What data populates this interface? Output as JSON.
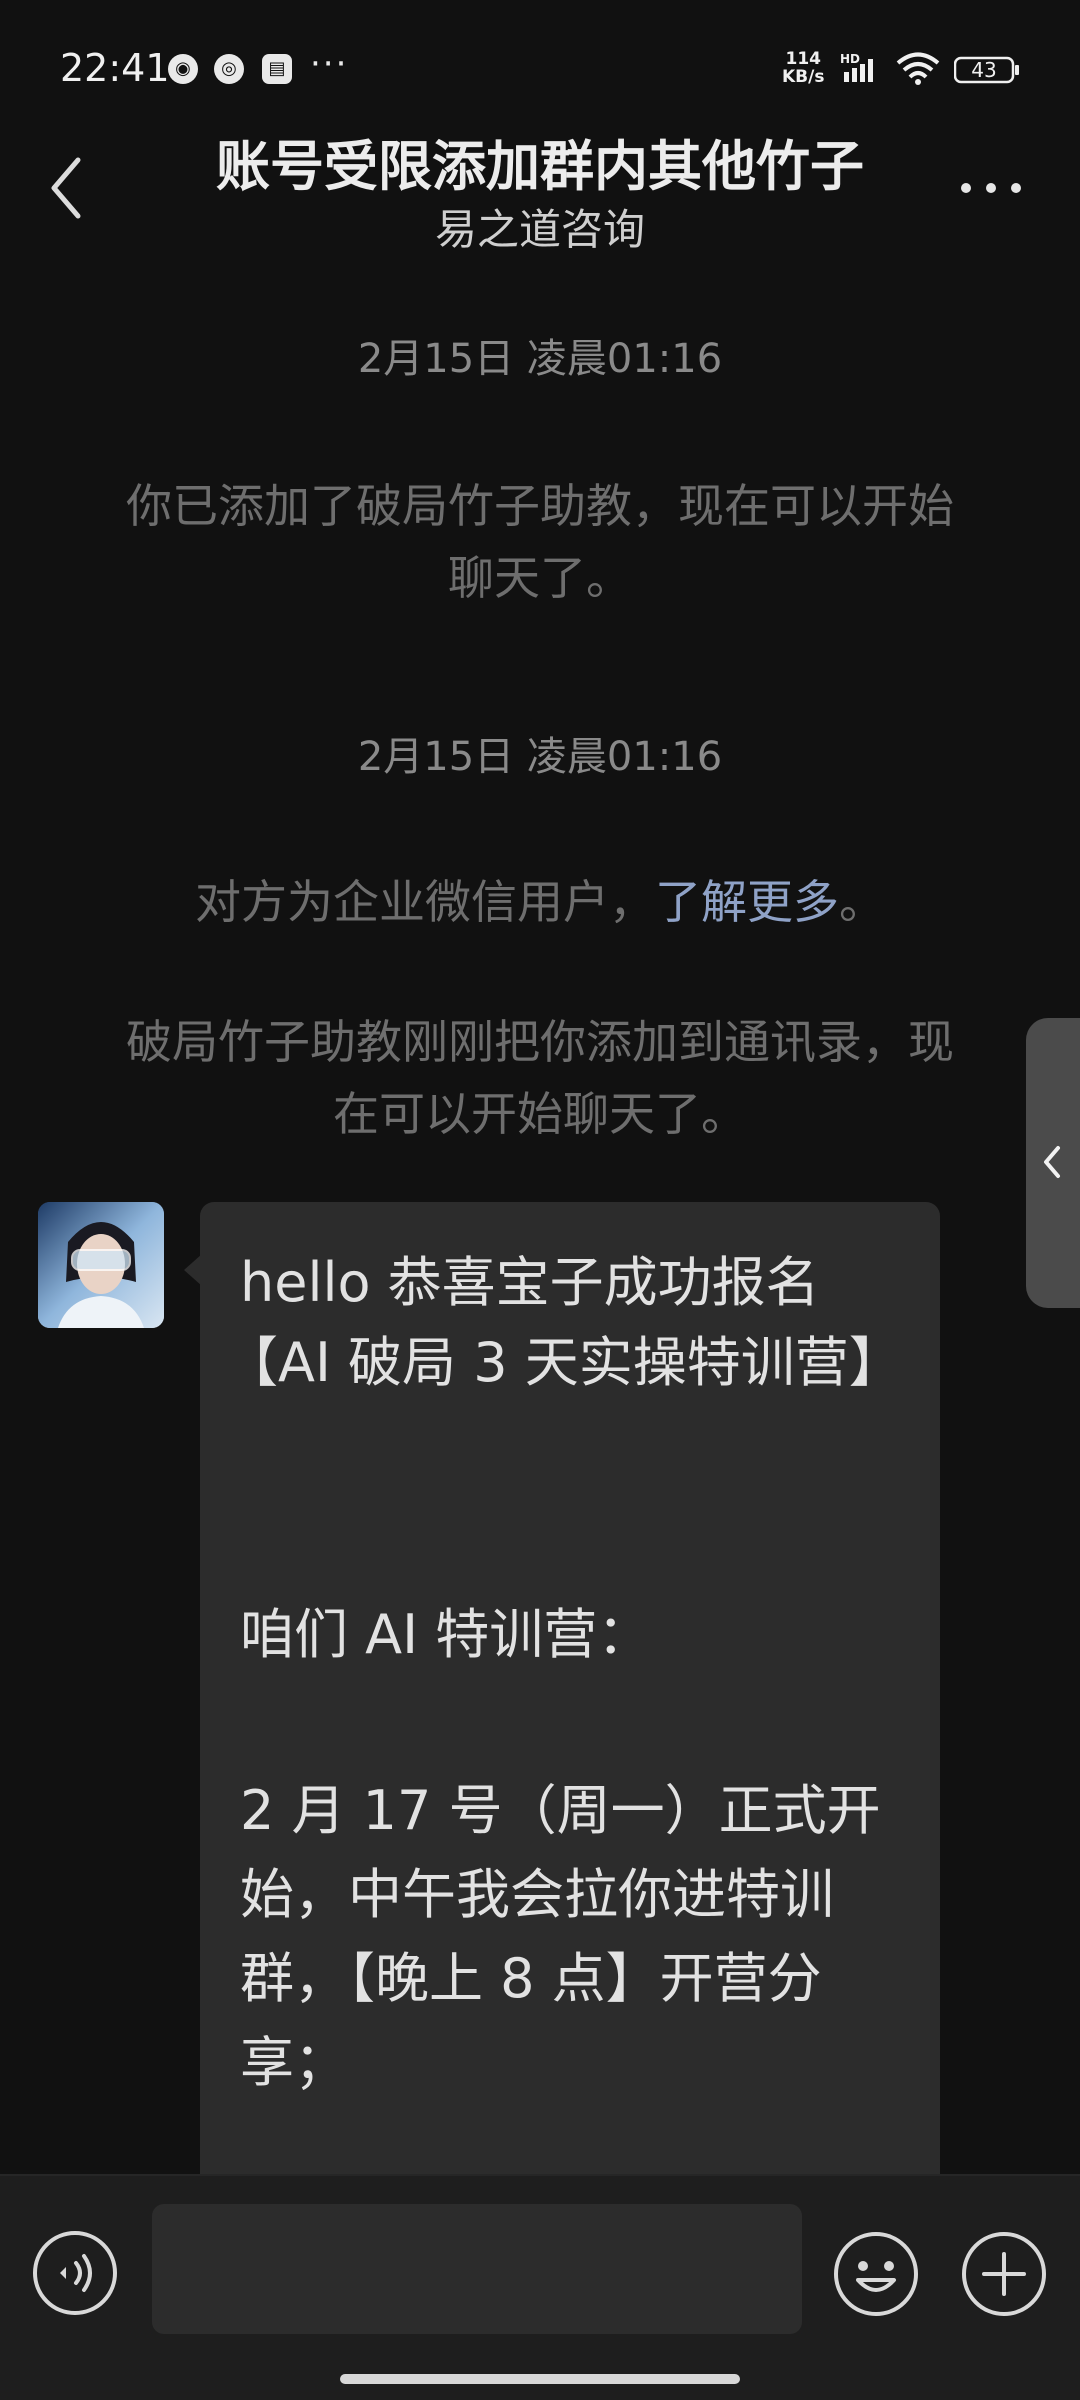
{
  "status_bar": {
    "time": "22:41",
    "notification_icons": [
      "app-notification-icon",
      "app-notification-icon",
      "app-notification-icon"
    ],
    "more_notifications": "···",
    "net_speed_value": "114",
    "net_speed_unit": "KB/s",
    "hd_label": "HD",
    "battery": "43"
  },
  "header": {
    "title": "账号受限添加群内其他竹子",
    "subtitle": "易之道咨询",
    "back_icon": "chevron-left-icon",
    "more_icon": "more-dots-icon"
  },
  "messages": {
    "timestamp_1": "2月15日 凌晨01:16",
    "system_1_line1": "你已添加了破局竹子助教，现在可以开始",
    "system_1_line2": "聊天了。",
    "timestamp_2": "2月15日 凌晨01:16",
    "system_2_prefix": "对方为企业微信用户，",
    "system_2_link": "了解更多",
    "system_2_suffix": "。",
    "system_3_line1": "破局竹子助教刚刚把你添加到通讯录，现",
    "system_3_line2": "在可以开始聊天了。",
    "bubble_lines": [
      "hello 恭喜宝子成功报名",
      "【AI 破局 3 天实操特训营】",
      "咱们 AI 特训营：",
      "2 月 17 号（周一）正式开",
      "始，中午我会拉你进特训",
      "群，【晚上 8 点】开营分",
      "享；"
    ]
  },
  "side_tab": {
    "icon": "chevron-left-icon"
  },
  "bottom_bar": {
    "voice_icon": "voice-input-icon",
    "input_value": "",
    "emoji_icon": "emoji-icon",
    "plus_icon": "plus-icon"
  },
  "colors": {
    "background": "#111111",
    "bubble": "#2c2c2c",
    "link": "#8fa2c7",
    "system_text": "#6e6e6e"
  }
}
